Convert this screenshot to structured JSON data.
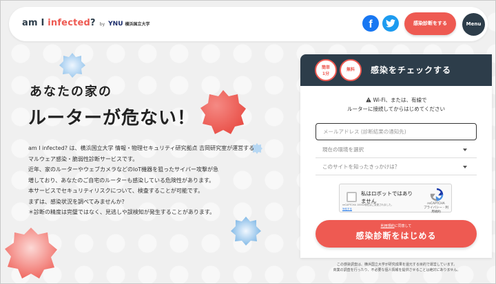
{
  "header": {
    "logo_main_prefix": "am I ",
    "logo_main_accent": "infected",
    "logo_main_suffix": "?",
    "logo_by": "by",
    "logo_ynu": "YNU",
    "logo_university": "横浜国立大学",
    "facebook_glyph": "f",
    "diagnose_button": "感染診断をする",
    "menu_button": "Menu"
  },
  "hero": {
    "line1": "あなたの家の",
    "line2": "ルーターが危ない！"
  },
  "description": [
    "am I infected? は、横浜国立大学 情報・物理セキュリティ研究拠点 吉岡研究室が運営する",
    "マルウェア感染・脆弱性診断サービスです。",
    "近年、家のルーターやウェブカメラなどのIoT機器を狙ったサイバー攻撃が急",
    "増しており、あなたのご自宅のルーターも感染している危険性があります。",
    "本サービスでセキュリティリスクについて、検査することが可能です。",
    "まずは、感染状況を調べてみませんか？",
    "＊診断の精度は完璧ではなく、見逃しや誤検知が発生することがあります。"
  ],
  "panel": {
    "badge_easy_top": "簡単",
    "badge_easy_bottom": "1分",
    "badge_free": "無料",
    "title": "感染をチェックする",
    "notice_line1": "Wi-Fi、または、有線で",
    "notice_line2": "ルーターに接続してからはじめてください",
    "email_placeholder": "メールアドレス (診断結果の通知先)",
    "environment_select": "現在の環境を選択",
    "source_select": "このサイトを知ったきっかけは？",
    "captcha": {
      "label_line1": "私はロボットではあり",
      "label_line2": "ません",
      "brand": "reCAPTCHA",
      "brand_sub": "プライバシー - 利用規約",
      "small_text": "reCAPTCHA 10002現在はご変更されました。",
      "small_link": "対処する"
    },
    "consent_link": "利用規約",
    "consent_rest": "に同意して",
    "start_button": "感染診断をはじめる"
  },
  "footnote": {
    "line1": "この感染調査は、横浜国立大学が研究成果を還元する目的で運営しています。",
    "line2": "商業の調査を行ったり、不必要な個人情報を提供させることは絶対にありません。"
  },
  "colors": {
    "accent": "#ee5a52",
    "navy": "#2d3d4a",
    "facebook": "#1877f2",
    "twitter": "#1d9bf0"
  },
  "icons": [
    "facebook-icon",
    "twitter-icon",
    "warning-icon",
    "chevron-down-icon",
    "recaptcha-icon"
  ]
}
